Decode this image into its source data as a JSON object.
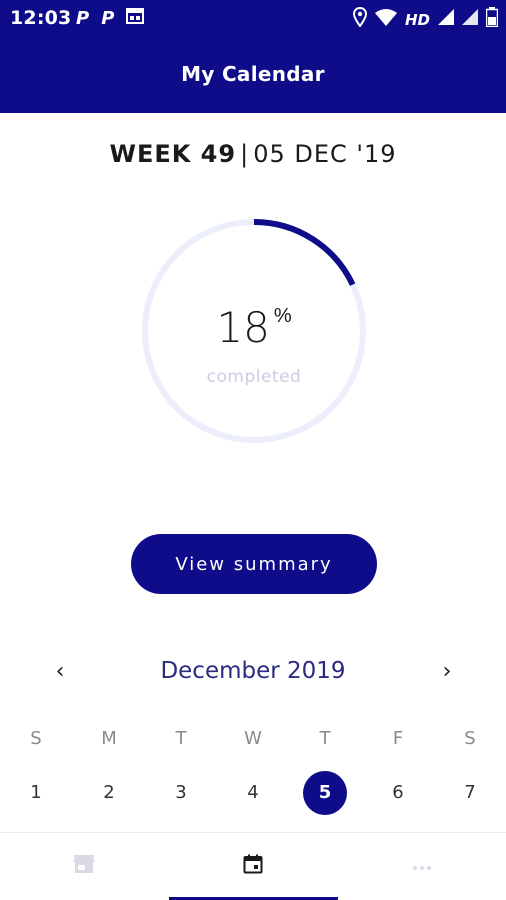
{
  "status_bar": {
    "time": "12:03",
    "left_icons": [
      "p-notification-icon",
      "p-notification-icon",
      "calendar-notification-icon"
    ],
    "right_icons": [
      "location-icon",
      "wifi-icon",
      "hd-label",
      "signal-icon",
      "signal-icon",
      "battery-icon"
    ],
    "hd_label": "HD"
  },
  "app_bar": {
    "title": "My Calendar"
  },
  "week_header": {
    "week": "WEEK 49",
    "separator": "|",
    "date": "05 DEC '19"
  },
  "progress": {
    "value": 18,
    "value_label": "18",
    "unit": "%",
    "caption": "completed"
  },
  "summary_button": {
    "label": "View summary"
  },
  "calendar": {
    "month_label": "December  2019",
    "prev_icon": "chevron-left-icon",
    "next_icon": "chevron-right-icon",
    "prev_glyph": "‹",
    "next_glyph": "›",
    "weekdays": [
      "S",
      "M",
      "T",
      "W",
      "T",
      "F",
      "S"
    ],
    "days": [
      "1",
      "2",
      "3",
      "4",
      "5",
      "6",
      "7"
    ],
    "selected_day": "5"
  },
  "bottom_nav": {
    "tabs": [
      {
        "icon": "store-icon",
        "active": false
      },
      {
        "icon": "calendar-icon",
        "active": true
      },
      {
        "icon": "more-horizontal-icon",
        "active": false
      }
    ]
  },
  "colors": {
    "primary": "#0f0c8a",
    "ring_track": "#eceefb",
    "muted_text": "#c9cde6"
  }
}
